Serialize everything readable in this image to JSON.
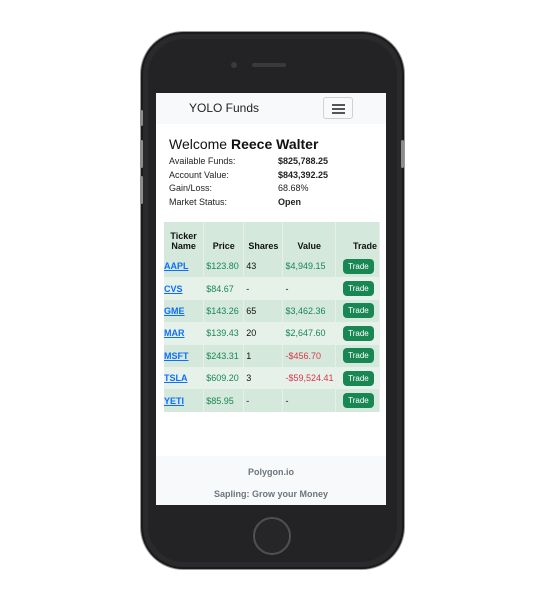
{
  "navbar": {
    "brand": "YOLO Funds"
  },
  "welcome": {
    "prefix": "Welcome",
    "name": "Reece Walter"
  },
  "account": [
    {
      "label": "Available Funds:",
      "value": "$825,788.25",
      "bold": true
    },
    {
      "label": "Account Value:",
      "value": "$843,392.25",
      "bold": true
    },
    {
      "label": "Gain/Loss:",
      "value": "68.68%",
      "bold": false
    },
    {
      "label": "Market Status:",
      "value": "Open",
      "bold": true
    }
  ],
  "table": {
    "headers": {
      "ticker": "Ticker Name",
      "price": "Price",
      "shares": "Shares",
      "value": "Value",
      "trade": "Trade"
    },
    "rows": [
      {
        "ticker": "AAPL",
        "price": "$123.80",
        "shares": "43",
        "value": "$4,949.15",
        "trade": "Trade"
      },
      {
        "ticker": "CVS",
        "price": "$84.67",
        "shares": "-",
        "value": "-",
        "trade": "Trade"
      },
      {
        "ticker": "GME",
        "price": "$143.26",
        "shares": "65",
        "value": "$3,462.36",
        "trade": "Trade"
      },
      {
        "ticker": "MAR",
        "price": "$139.43",
        "shares": "20",
        "value": "$2,647.60",
        "trade": "Trade"
      },
      {
        "ticker": "MSFT",
        "price": "$243.31",
        "shares": "1",
        "value": "-$456.70",
        "trade": "Trade"
      },
      {
        "ticker": "TSLA",
        "price": "$609.20",
        "shares": "3",
        "value": "-$59,524.41",
        "trade": "Trade"
      },
      {
        "ticker": "YETI",
        "price": "$85.95",
        "shares": "-",
        "value": "-",
        "trade": "Trade"
      }
    ]
  },
  "footer": {
    "line1": "Polygon.io",
    "line2": "Sapling: Grow your Money"
  },
  "colors": {
    "positive": "#198754",
    "negative": "#dc3545",
    "link": "#0d6efd",
    "row_tint": "#d4e8dc"
  },
  "icons": {
    "menu": "hamburger-menu-icon"
  }
}
